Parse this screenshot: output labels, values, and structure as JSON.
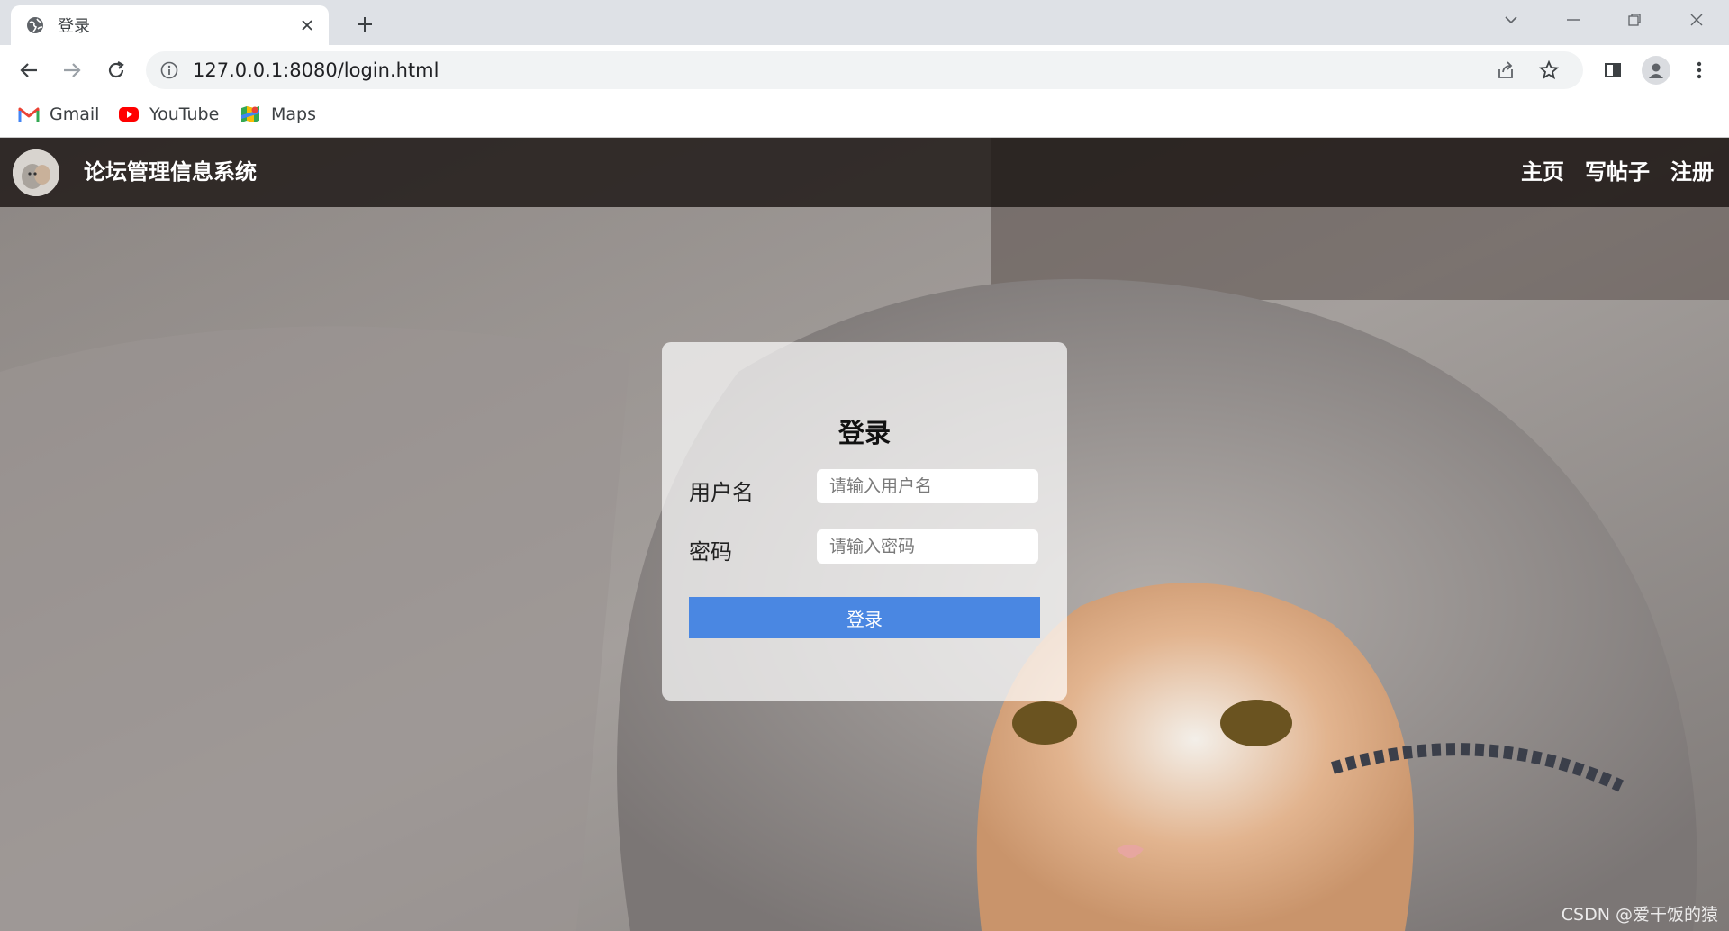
{
  "browser": {
    "tab_title": "登录",
    "url": "127.0.0.1:8080/login.html",
    "bookmarks": [
      {
        "label": "Gmail",
        "icon": "gmail-icon"
      },
      {
        "label": "YouTube",
        "icon": "youtube-icon"
      },
      {
        "label": "Maps",
        "icon": "maps-icon"
      }
    ]
  },
  "site": {
    "title": "论坛管理信息系统",
    "nav": [
      "主页",
      "写帖子",
      "注册"
    ]
  },
  "login": {
    "title": "登录",
    "username_label": "用户名",
    "username_placeholder": "请输入用户名",
    "password_label": "密码",
    "password_placeholder": "请输入密码",
    "submit_label": "登录"
  },
  "watermark": "CSDN @爱干饭的猿",
  "colors": {
    "accent": "#4a87e2",
    "nav_bg": "#1c1614"
  }
}
